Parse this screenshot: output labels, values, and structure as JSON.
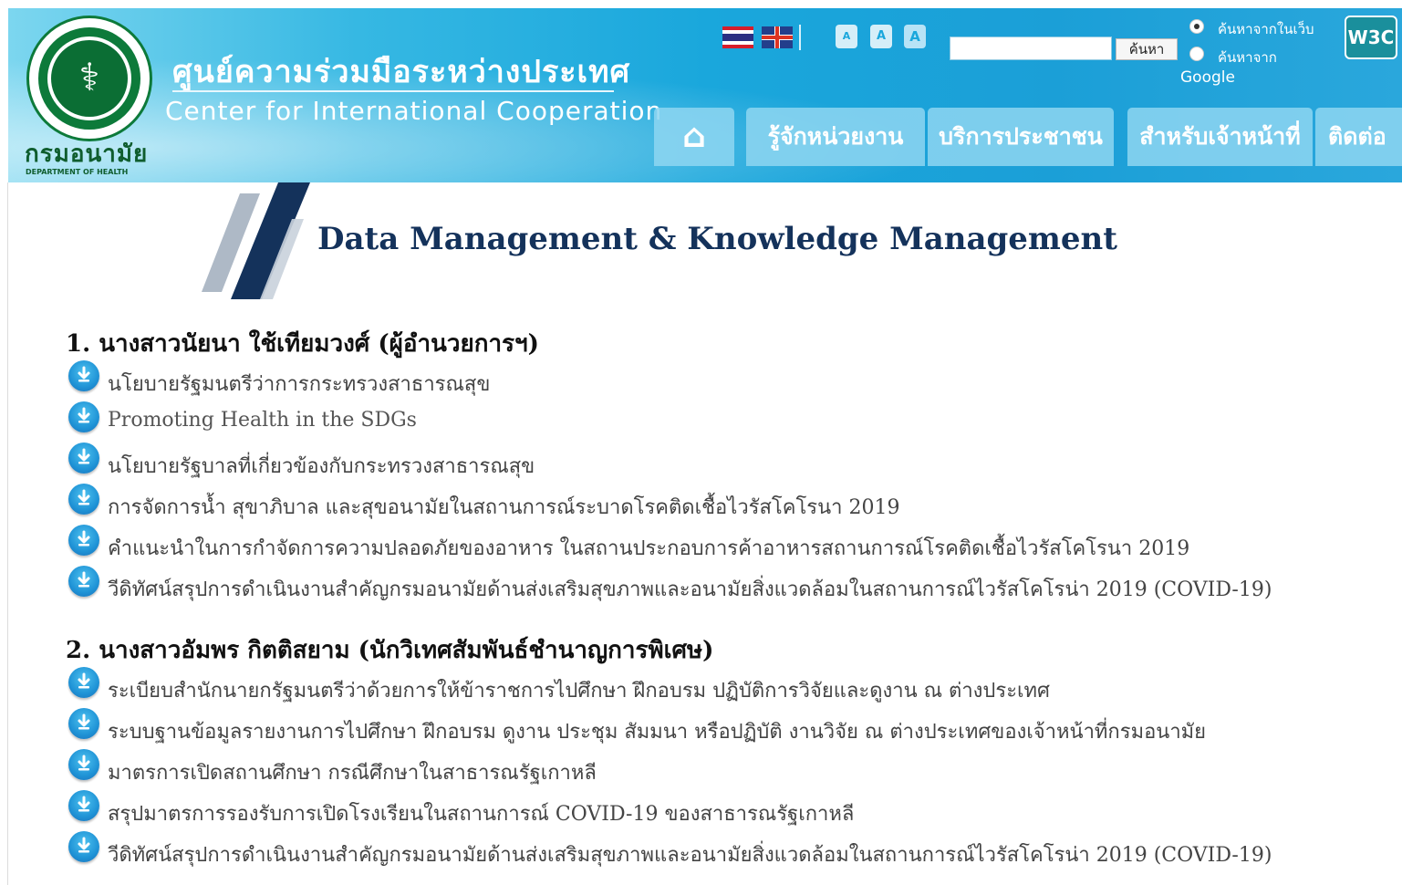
{
  "header": {
    "site_title_th": "ศูนย์ความร่วมมือระหว่างประเทศ",
    "site_title_en": "Center for International Cooperation",
    "dept_th": "กรมอนามัย",
    "dept_en": "DEPARTMENT OF HEALTH",
    "font_buttons": [
      "A",
      "A",
      "A"
    ],
    "search": {
      "button_label": "ค้นหา",
      "input_value": "",
      "option_site": "ค้นหาจากในเว็บ",
      "option_google": "ค้นหาจาก",
      "google": "Google"
    },
    "w3c": "W3C",
    "nav": [
      "รู้จักหน่วยงาน",
      "บริการประชาชน",
      "สำหรับเจ้าหน้าที่",
      "ติดต่อ"
    ],
    "icons": [
      "thai-flag-icon",
      "uk-flag-icon",
      "home-icon",
      "download-icon"
    ]
  },
  "main": {
    "title": "Data Management & Knowledge Management",
    "sections": [
      {
        "heading": "1. นางสาวนัยนา ใช้เทียมวงศ์ (ผู้อำนวยการฯ)",
        "items": [
          "นโยบายรัฐมนตรีว่าการกระทรวงสาธารณสุข",
          "Promoting Health in the SDGs",
          "นโยบายรัฐบาลที่เกี่ยวข้องกับกระทรวงสาธารณสุข",
          "การจัดการน้ำ สุขาภิบาล และสุขอนามัยในสถานการณ์ระบาดโรคติดเชื้อไวรัสโคโรนา 2019",
          "คำแนะนำในการกำจัดการความปลอดภัยของอาหาร ในสถานประกอบการค้าอาหารสถานการณ์โรคติดเชื้อไวรัสโคโรนา 2019",
          "วีดิทัศน์สรุปการดำเนินงานสำคัญกรมอนามัยด้านส่งเสริมสุขภาพและอนามัยสิ่งแวดล้อมในสถานการณ์ไวรัสโคโรน่า 2019 (COVID-19)"
        ]
      },
      {
        "heading": "2. นางสาวอัมพร กิตติสยาม (นักวิเทศสัมพันธ์ชำนาญการพิเศษ)",
        "items": [
          "ระเบียบสำนักนายกรัฐมนตรีว่าด้วยการให้ข้าราชการไปศึกษา ฝึกอบรม ปฏิบัติการวิจัยและดูงาน ณ ต่างประเทศ",
          "ระบบฐานข้อมูลรายงานการไปศึกษา ฝึกอบรม ดูงาน ประชุม สัมมนา หรือปฏิบัติ งานวิจัย ณ ต่างประเทศของเจ้าหน้าที่กรมอนามัย",
          "มาตรการเปิดสถานศึกษา กรณีศึกษาในสาธารณรัฐเกาหลี",
          "สรุปมาตรการรองรับการเปิดโรงเรียนในสถานการณ์ COVID-19 ของสาธารณรัฐเกาหลี",
          "วีดิทัศน์สรุปการดำเนินงานสำคัญกรมอนามัยด้านส่งเสริมสุขภาพและอนามัยสิ่งแวดล้อมในสถานการณ์ไวรัสโคโรน่า 2019 (COVID-19)"
        ]
      }
    ]
  },
  "colors": {
    "header_blue": "#1aa7dc",
    "title_navy": "#14325b",
    "dept_green": "#0f5d2e",
    "download_blue": "#1f93d6"
  }
}
